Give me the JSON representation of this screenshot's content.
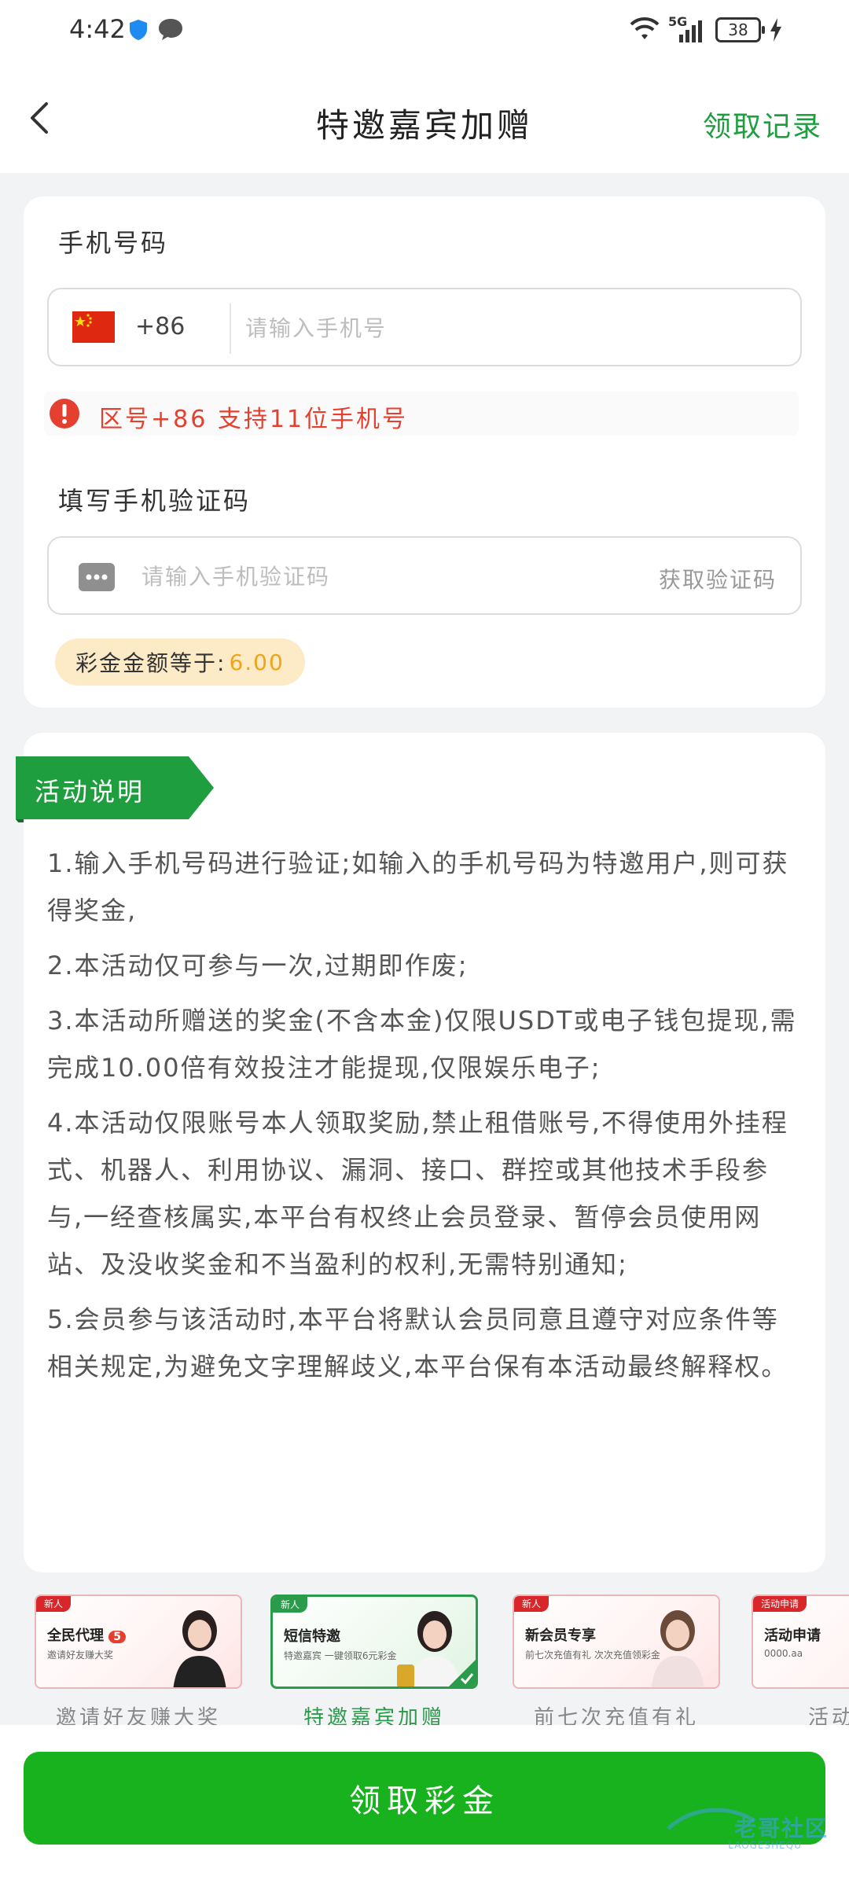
{
  "status_bar": {
    "time": "4:42",
    "network": "5G",
    "battery": "38",
    "icons": [
      "shield-icon",
      "chat-icon",
      "wifi-icon",
      "signal-icon",
      "battery-icon",
      "charging-icon"
    ]
  },
  "header": {
    "title": "特邀嘉宾加赠",
    "records_label": "领取记录",
    "back_icon": "chevron-left-icon"
  },
  "form": {
    "phone_label": "手机号码",
    "country_code": "+86",
    "phone_placeholder": "请输入手机号",
    "phone_hint": "区号+86 支持11位手机号",
    "code_label": "填写手机验证码",
    "code_placeholder": "请输入手机验证码",
    "get_code_label": "获取验证码",
    "bonus_label": "彩金金额等于:",
    "bonus_amount": "6.00"
  },
  "description": {
    "title": "活动说明",
    "items": [
      "1.输入手机号码进行验证;如输入的手机号码为特邀用户,则可获得奖金,",
      "2.本活动仅可参与一次,过期即作废;",
      "3.本活动所赠送的奖金(不含本金)仅限USDT或电子钱包提现,需完成10.00倍有效投注才能提现,仅限娱乐电子;",
      "4.本活动仅限账号本人领取奖励,禁止租借账号,不得使用外挂程式、机器人、利用协议、漏洞、接口、群控或其他技术手段参与,一经查核属实,本平台有权终止会员登录、暂停会员使用网站、及没收奖金和不当盈利的权利,无需特别通知;",
      "5.会员参与该活动时,本平台将默认会员同意且遵守对应条件等相关规定,为避免文字理解歧义,本平台保有本活动最终解释权。"
    ]
  },
  "banners": [
    {
      "tag": "新人",
      "title": "全民代理",
      "badge": "5",
      "subtitle": "邀请好友赚大奖",
      "caption": "邀请好友赚大奖",
      "active": false
    },
    {
      "tag": "新人",
      "title": "短信特邀",
      "subtitle": "特邀嘉宾 一键领取6元彩金",
      "caption": "特邀嘉宾加赠",
      "active": true
    },
    {
      "tag": "新人",
      "title": "新会员专享",
      "subtitle": "前七次充值有礼 次次充值领彩金",
      "caption": "前七次充值有礼",
      "active": false
    },
    {
      "tag": "活动申请",
      "title": "活动申请",
      "subtitle": "0000.aa",
      "caption": "活动申请",
      "active": false
    }
  ],
  "footer": {
    "claim_label": "领取彩金",
    "watermark": "老哥社区",
    "watermark_sub": "LAOGESHEQU"
  },
  "colors": {
    "accent_green": "#18b21e",
    "title_green": "#1e9e3e",
    "warning_red": "#e5402f",
    "bonus_orange": "#f0a417"
  }
}
